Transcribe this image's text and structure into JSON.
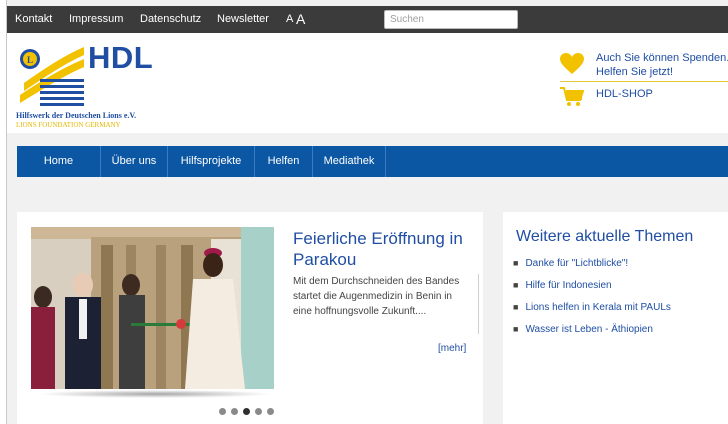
{
  "topbar": {
    "links": [
      "Kontakt",
      "Impressum",
      "Datenschutz",
      "Newsletter"
    ],
    "font_small": "A",
    "font_large": "A",
    "search_placeholder": "Suchen"
  },
  "header": {
    "logo_text": "HDL",
    "logo_subtitle": "Hilfswerk der Deutschen Lions e.V.",
    "logo_subtitle2": "LIONS FOUNDATION GERMANY",
    "donate_line1": "Auch Sie können Spenden.",
    "donate_line2": "Helfen Sie jetzt!",
    "shop_label": "HDL-SHOP",
    "donate_icon": "heart-icon",
    "shop_icon": "cart-icon"
  },
  "nav": {
    "items": [
      "Home",
      "Über uns",
      "Hilfsprojekte",
      "Helfen",
      "Mediathek"
    ]
  },
  "featured": {
    "title": "Feierliche Eröffnung in Parakou",
    "text": "Mit dem Durchschneiden des Bandes startet die Augenmedizin in Benin in eine hoffnungsvolle Zukunft....",
    "more": "[mehr]",
    "slides_total": 5,
    "slide_active": 3
  },
  "topics": {
    "title": "Weitere aktuelle Themen",
    "items": [
      "Danke für \"Lichtblicke\"!",
      "Hilfe für Indonesien",
      "Lions helfen in Kerala mit PAULs",
      "Wasser ist Leben - Äthiopien"
    ]
  },
  "colors": {
    "brand_blue": "#1f4ea3",
    "nav_blue": "#0c57a3",
    "topbar": "#3b3b3b",
    "accent_yellow": "#f2c200"
  }
}
